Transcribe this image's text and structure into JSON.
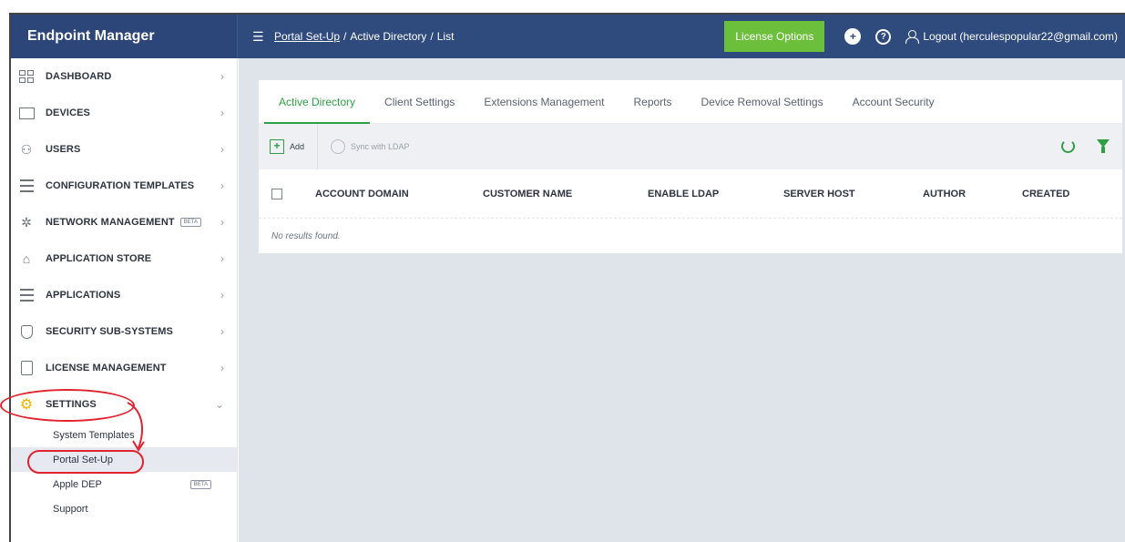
{
  "header": {
    "brand": "Endpoint Manager",
    "breadcrumb": [
      "Portal Set-Up",
      "/",
      "Active Directory",
      "/",
      "List"
    ],
    "license_button": "License Options",
    "logout": "Logout (herculespopular22@gmail.com)"
  },
  "sidebar": {
    "items": [
      {
        "label": "DASHBOARD",
        "icon": "dashboard-icon"
      },
      {
        "label": "DEVICES",
        "icon": "devices-icon"
      },
      {
        "label": "USERS",
        "icon": "users-icon"
      },
      {
        "label": "CONFIGURATION TEMPLATES",
        "icon": "templates-icon"
      },
      {
        "label": "NETWORK MANAGEMENT",
        "icon": "network-icon",
        "badge": "BETA"
      },
      {
        "label": "APPLICATION STORE",
        "icon": "store-icon"
      },
      {
        "label": "APPLICATIONS",
        "icon": "applications-icon"
      },
      {
        "label": "SECURITY SUB-SYSTEMS",
        "icon": "shield-icon"
      },
      {
        "label": "LICENSE MANAGEMENT",
        "icon": "license-icon"
      },
      {
        "label": "SETTINGS",
        "icon": "gear-icon"
      }
    ],
    "settings_sub": [
      {
        "label": "System Templates"
      },
      {
        "label": "Portal Set-Up"
      },
      {
        "label": "Apple DEP",
        "badge": "BETA"
      },
      {
        "label": "Support"
      }
    ]
  },
  "tabs": [
    "Active Directory",
    "Client Settings",
    "Extensions Management",
    "Reports",
    "Device Removal Settings",
    "Account Security"
  ],
  "toolbar": {
    "add": "Add",
    "sync": "Sync with LDAP"
  },
  "table": {
    "columns": [
      "ACCOUNT DOMAIN",
      "CUSTOMER NAME",
      "ENABLE LDAP",
      "SERVER HOST",
      "AUTHOR",
      "CREATED"
    ],
    "empty_message": "No results found."
  },
  "colors": {
    "header_bg": "#2f4a7c",
    "accent_green": "#2f9e44",
    "license_green": "#6cbf3b",
    "annotation_red": "#e0242f"
  }
}
